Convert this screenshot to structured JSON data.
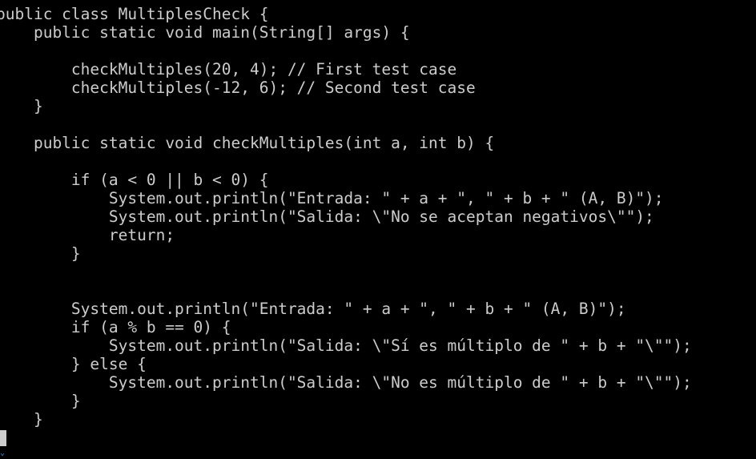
{
  "terminal": {
    "code_lines": [
      "public class MultiplesCheck {",
      "    public static void main(String[] args) {",
      "",
      "        checkMultiples(20, 4); // First test case",
      "        checkMultiples(-12, 6); // Second test case",
      "    }",
      "",
      "    public static void checkMultiples(int a, int b) {",
      "",
      "        if (a < 0 || b < 0) {",
      "            System.out.println(\"Entrada: \" + a + \", \" + b + \" (A, B)\");",
      "            System.out.println(\"Salida: \\\"No se aceptan negativos\\\"\");",
      "            return;",
      "        }",
      "",
      "",
      "        System.out.println(\"Entrada: \" + a + \", \" + b + \" (A, B)\");",
      "        if (a % b == 0) {",
      "            System.out.println(\"Salida: \\\"Sí es múltiplo de \" + b + \"\\\"\");",
      "        } else {",
      "            System.out.println(\"Salida: \\\"No es múltiplo de \" + b + \"\\\"\");",
      "        }",
      "    }"
    ],
    "colors": {
      "background": "#000000",
      "text": "#cccccc",
      "marker": "#3a96dd"
    },
    "cursor_icon": "block-cursor-icon",
    "scroll_icon": "scroll-marker-icon"
  }
}
